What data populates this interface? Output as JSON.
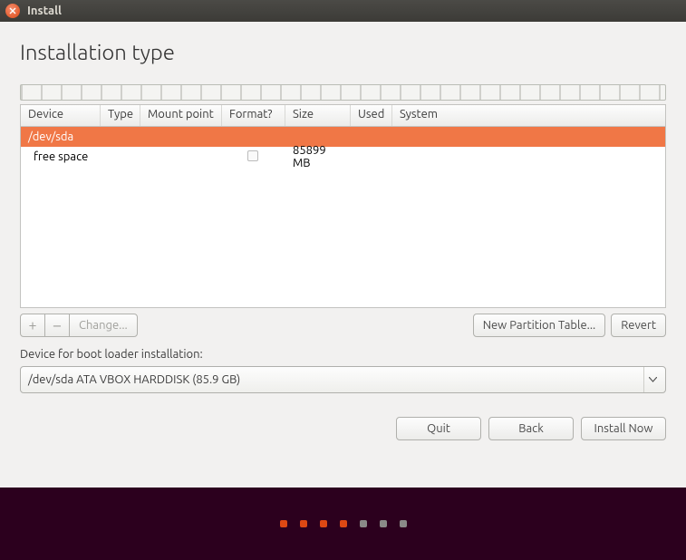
{
  "window": {
    "title": "Install"
  },
  "page": {
    "heading": "Installation type"
  },
  "table": {
    "headers": {
      "device": "Device",
      "type": "Type",
      "mount": "Mount point",
      "format": "Format?",
      "size": "Size",
      "used": "Used",
      "system": "System"
    },
    "rows": [
      {
        "device": "/dev/sda",
        "type": "",
        "mount": "",
        "format": "",
        "size": "",
        "used": "",
        "system": "",
        "selected": true
      },
      {
        "device": "  free space",
        "type": "",
        "mount": "",
        "format_checkbox": true,
        "size": "85899 MB",
        "used": "",
        "system": "",
        "selected": false
      }
    ]
  },
  "toolbar": {
    "add": "+",
    "remove": "−",
    "change": "Change...",
    "new_table": "New Partition Table...",
    "revert": "Revert"
  },
  "bootloader": {
    "label": "Device for boot loader installation:",
    "value": "/dev/sda  ATA VBOX HARDDISK (85.9 GB)"
  },
  "nav": {
    "quit": "Quit",
    "back": "Back",
    "install": "Install Now"
  },
  "progress": {
    "total": 7,
    "current": 4
  }
}
